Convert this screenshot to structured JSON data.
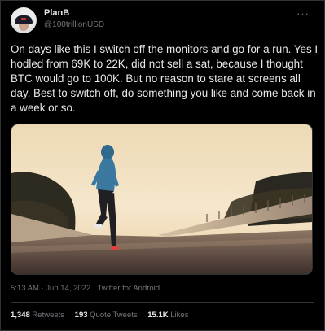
{
  "tweet": {
    "author_name": "PlanB",
    "author_handle": "@100trillionUSD",
    "more_icon": "more-horizontal-icon",
    "text": "On days like this I switch off the monitors and go for a run. Yes I hodled from 69K to 22K, did not sell a sat, because I thought BTC would go to 100K. But no reason to stare at screens all day. Best to switch off, do something you like and come back in a week or so.",
    "timestamp": "5:13 AM · Jun 14, 2022",
    "separator": " · ",
    "source": "Twitter for Android"
  },
  "stats": {
    "retweets_count": "1,348",
    "retweets_label": "Retweets",
    "quote_count": "193",
    "quote_label": "Quote Tweets",
    "likes_count": "15.1K",
    "likes_label": "Likes"
  },
  "colors": {
    "background": "#000000",
    "text": "#e7e9ea",
    "muted": "#71767b",
    "border": "#2f3336"
  }
}
